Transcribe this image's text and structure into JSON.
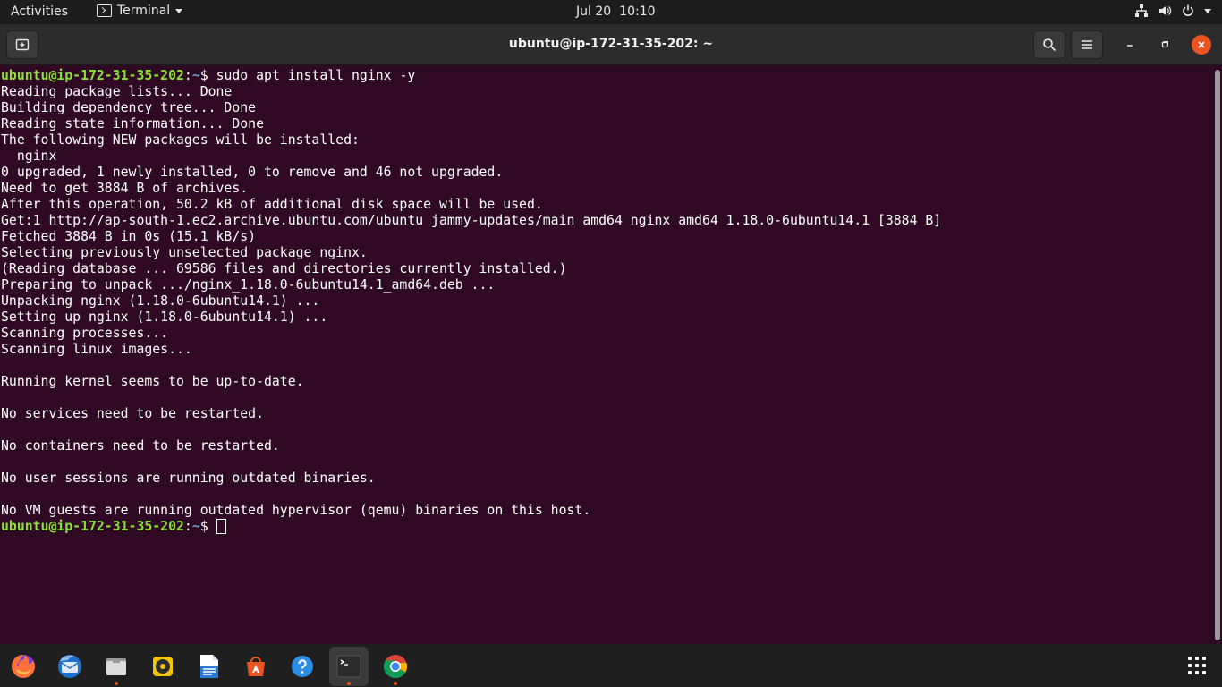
{
  "topbar": {
    "activities": "Activities",
    "app_menu": "Terminal",
    "date": "Jul 20",
    "time": "10:10"
  },
  "window": {
    "title": "ubuntu@ip-172-31-35-202: ~"
  },
  "terminal": {
    "prompt_user": "ubuntu@ip-172-31-35-202",
    "prompt_sep": ":",
    "prompt_path": "~",
    "prompt_symbol": "$ ",
    "command": "sudo apt install nginx -y",
    "output": [
      "Reading package lists... Done",
      "Building dependency tree... Done",
      "Reading state information... Done",
      "The following NEW packages will be installed:",
      "  nginx",
      "0 upgraded, 1 newly installed, 0 to remove and 46 not upgraded.",
      "Need to get 3884 B of archives.",
      "After this operation, 50.2 kB of additional disk space will be used.",
      "Get:1 http://ap-south-1.ec2.archive.ubuntu.com/ubuntu jammy-updates/main amd64 nginx amd64 1.18.0-6ubuntu14.1 [3884 B]",
      "Fetched 3884 B in 0s (15.1 kB/s)",
      "Selecting previously unselected package nginx.",
      "(Reading database ... 69586 files and directories currently installed.)",
      "Preparing to unpack .../nginx_1.18.0-6ubuntu14.1_amd64.deb ...",
      "Unpacking nginx (1.18.0-6ubuntu14.1) ...",
      "Setting up nginx (1.18.0-6ubuntu14.1) ...",
      "Scanning processes...",
      "Scanning linux images...",
      "",
      "Running kernel seems to be up-to-date.",
      "",
      "No services need to be restarted.",
      "",
      "No containers need to be restarted.",
      "",
      "No user sessions are running outdated binaries.",
      "",
      "No VM guests are running outdated hypervisor (qemu) binaries on this host."
    ]
  },
  "dock": {
    "items": [
      {
        "icon": "firefox-icon",
        "running": false,
        "active": false
      },
      {
        "icon": "thunderbird-icon",
        "running": false,
        "active": false
      },
      {
        "icon": "files-icon",
        "running": true,
        "active": false
      },
      {
        "icon": "rhythmbox-icon",
        "running": false,
        "active": false
      },
      {
        "icon": "libreoffice-writer-icon",
        "running": false,
        "active": false
      },
      {
        "icon": "software-center-icon",
        "running": false,
        "active": false
      },
      {
        "icon": "help-icon",
        "running": false,
        "active": false
      },
      {
        "icon": "terminal-icon",
        "running": true,
        "active": true
      },
      {
        "icon": "chrome-icon",
        "running": true,
        "active": false
      }
    ],
    "show_apps_icon": "app-grid-icon"
  },
  "colors": {
    "terminal_bg": "#300a24",
    "prompt_user": "#8ae234",
    "prompt_path": "#729fcf",
    "accent": "#e95420"
  }
}
